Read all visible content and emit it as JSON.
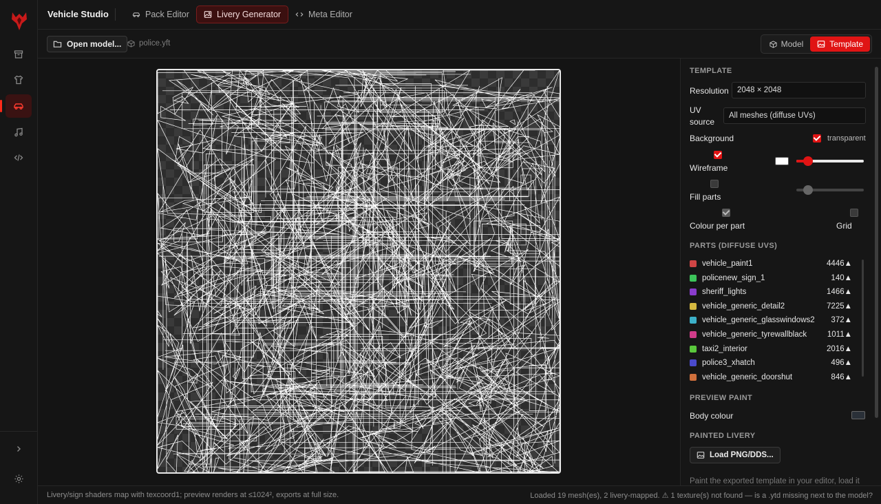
{
  "app": {
    "title": "Vehicle Studio"
  },
  "tabs": [
    {
      "label": "Pack Editor",
      "icon": "car-icon"
    },
    {
      "label": "Livery Generator",
      "icon": "image-icon",
      "active": true
    },
    {
      "label": "Meta Editor",
      "icon": "code-icon"
    }
  ],
  "rail": {
    "items": [
      "archive-icon",
      "shirt-icon",
      "car-icon",
      "music-icon",
      "code-icon"
    ],
    "active_index": 2,
    "bottom": [
      "chevron-right-icon",
      "gear-icon"
    ]
  },
  "toolbar": {
    "open_label": "Open model...",
    "filename": "police.yft"
  },
  "view_toggle": {
    "model_label": "Model",
    "template_label": "Template",
    "active": "Template"
  },
  "template": {
    "section": "TEMPLATE",
    "resolution_label": "Resolution",
    "resolution_value": "2048 × 2048",
    "uv_source_label_1": "UV",
    "uv_source_label_2": "source",
    "uv_source_value": "All meshes (diffuse UVs)",
    "background_label": "Background",
    "transparent_label": "transparent",
    "transparent_checked": true,
    "wireframe_label": "Wireframe",
    "wireframe_checked": true,
    "wireframe_color": "#ffffff",
    "wireframe_level": 0.17,
    "fill_parts_label": "Fill parts",
    "fill_parts_checked": false,
    "fill_level": 0.17,
    "colour_per_part_label": "Colour per part",
    "colour_per_part_checked": true,
    "grid_label": "Grid",
    "grid_checked": false
  },
  "parts_section": "PARTS (DIFFUSE UVS)",
  "parts": [
    {
      "name": "vehicle_paint1",
      "count": "4446▲",
      "color": "#d04545"
    },
    {
      "name": "policenew_sign_1",
      "count": "140▲",
      "color": "#3cc45a"
    },
    {
      "name": "sheriff_lights",
      "count": "1466▲",
      "color": "#8a3ccc"
    },
    {
      "name": "vehicle_generic_detail2",
      "count": "7225▲",
      "color": "#d4b840"
    },
    {
      "name": "vehicle_generic_glasswindows2",
      "count": "372▲",
      "color": "#3cb0c8"
    },
    {
      "name": "vehicle_generic_tyrewallblack",
      "count": "1011▲",
      "color": "#d03c8a"
    },
    {
      "name": "taxi2_interior",
      "count": "2016▲",
      "color": "#5ac83c"
    },
    {
      "name": "police3_xhatch",
      "count": "496▲",
      "color": "#4a4acc"
    },
    {
      "name": "vehicle_generic_doorshut",
      "count": "846▲",
      "color": "#d0703c"
    }
  ],
  "preview": {
    "section": "PREVIEW PAINT",
    "body_colour_label": "Body colour",
    "body_colour": "#2a3038"
  },
  "painted": {
    "section": "PAINTED LIVERY",
    "load_label": "Load PNG/DDS...",
    "hint": "Paint the exported template in your editor, load it"
  },
  "status": {
    "left": "Livery/sign shaders map with texcoord1; preview renders at ≤1024², exports at full size.",
    "right": "Loaded 19 mesh(es), 2 livery-mapped. ⚠ 1 texture(s) not found — is a .ytd missing next to the model?"
  },
  "colors": {
    "accent": "#e01414",
    "background": "#141414",
    "panel": "#161616"
  }
}
